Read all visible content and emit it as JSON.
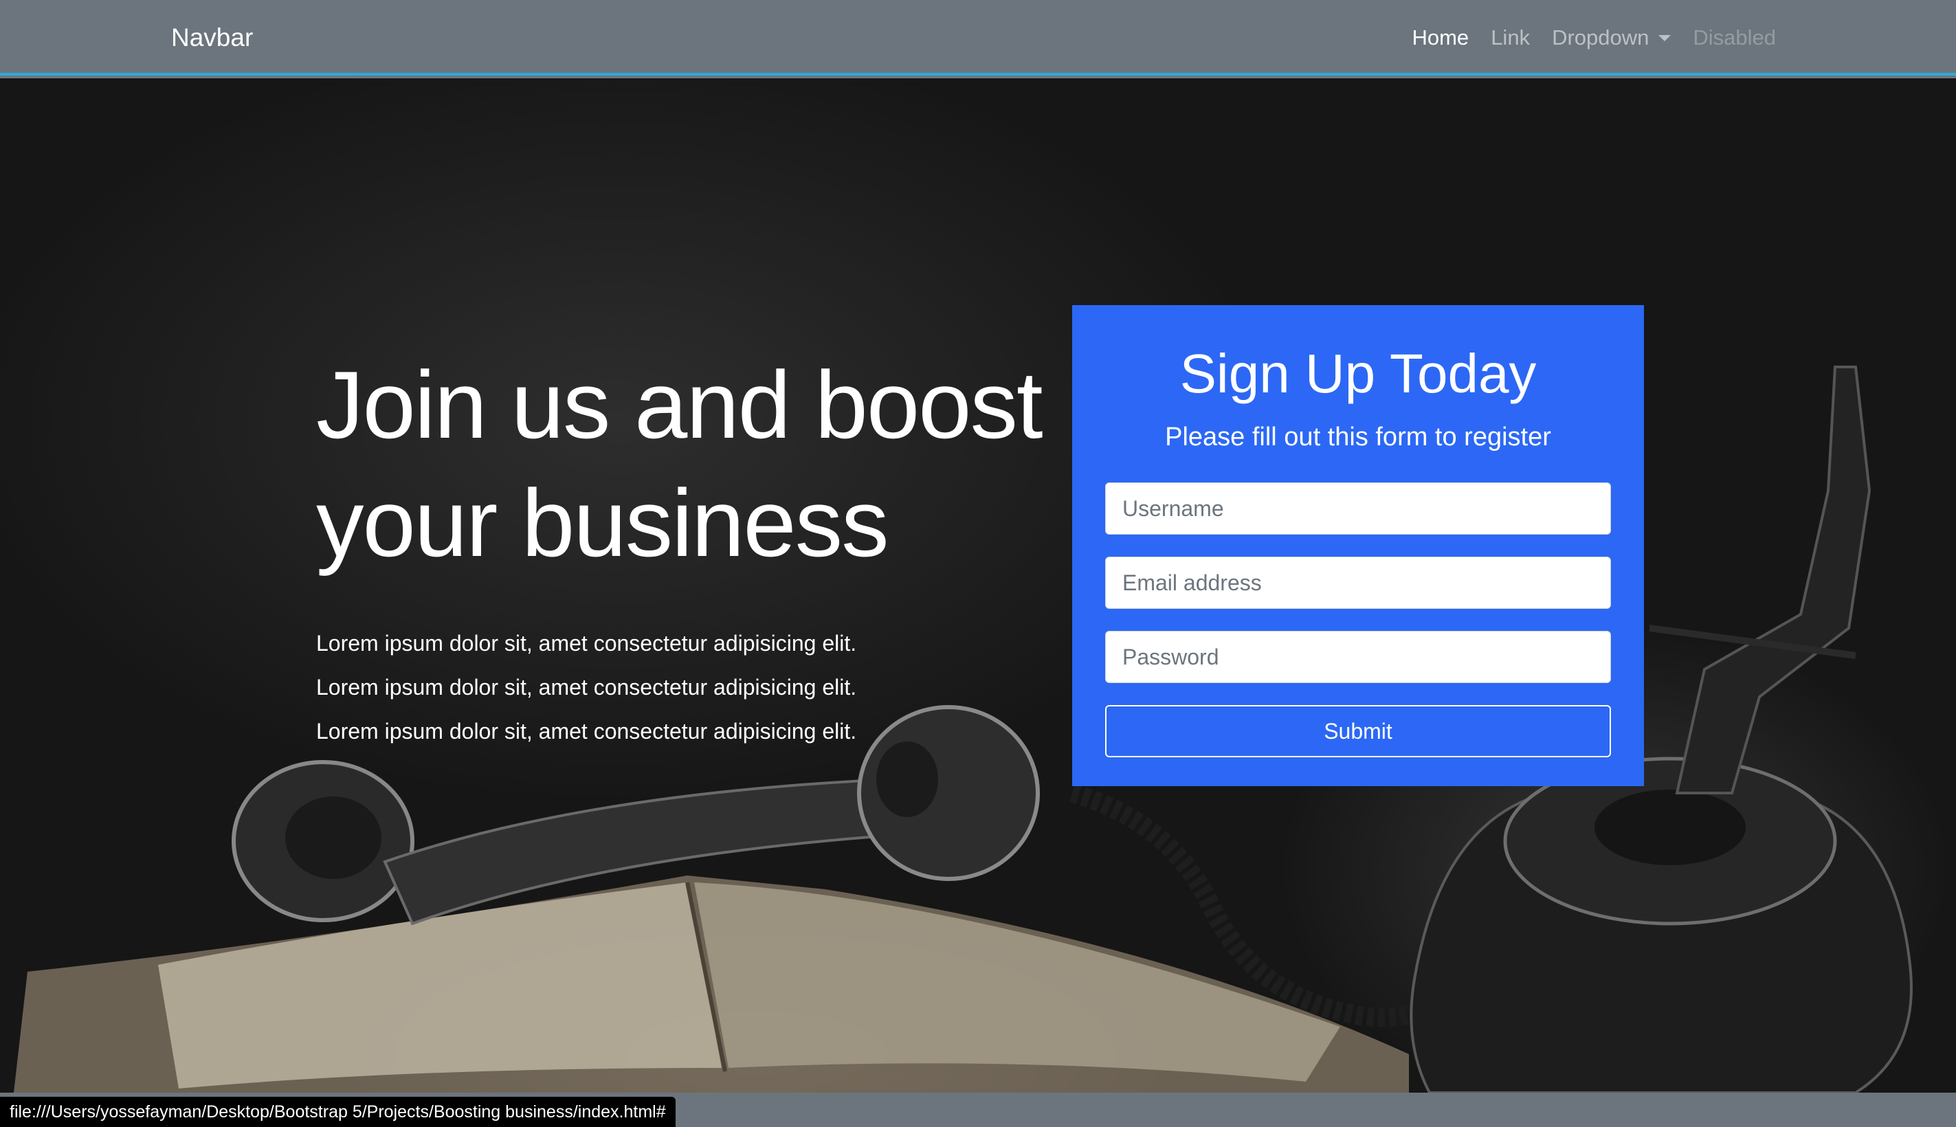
{
  "navbar": {
    "brand": "Navbar",
    "links": [
      {
        "label": "Home",
        "state": "active"
      },
      {
        "label": "Link",
        "state": "normal"
      },
      {
        "label": "Dropdown",
        "state": "normal"
      },
      {
        "label": "Disabled",
        "state": "disabled"
      }
    ]
  },
  "hero": {
    "title_line1": "Join us and boost",
    "title_line2": "your business",
    "lines": [
      "Lorem ipsum dolor sit, amet consectetur adipisicing elit.",
      "Lorem ipsum dolor sit, amet consectetur adipisicing elit.",
      "Lorem ipsum dolor sit, amet consectetur adipisicing elit."
    ]
  },
  "form": {
    "title": "Sign Up Today",
    "subtitle": "Please fill out this form to register",
    "username_placeholder": "Username",
    "email_placeholder": "Email address",
    "password_placeholder": "Password",
    "submit_label": "Submit"
  },
  "status_bar": {
    "url": "file:///Users/yossefayman/Desktop/Bootstrap 5/Projects/Boosting business/index.html#"
  },
  "colors": {
    "navbar_bg": "#6c757d",
    "navbar_border": "#2fa9d6",
    "form_bg": "#2c68f5",
    "hero_bg": "#1a1a1a"
  }
}
